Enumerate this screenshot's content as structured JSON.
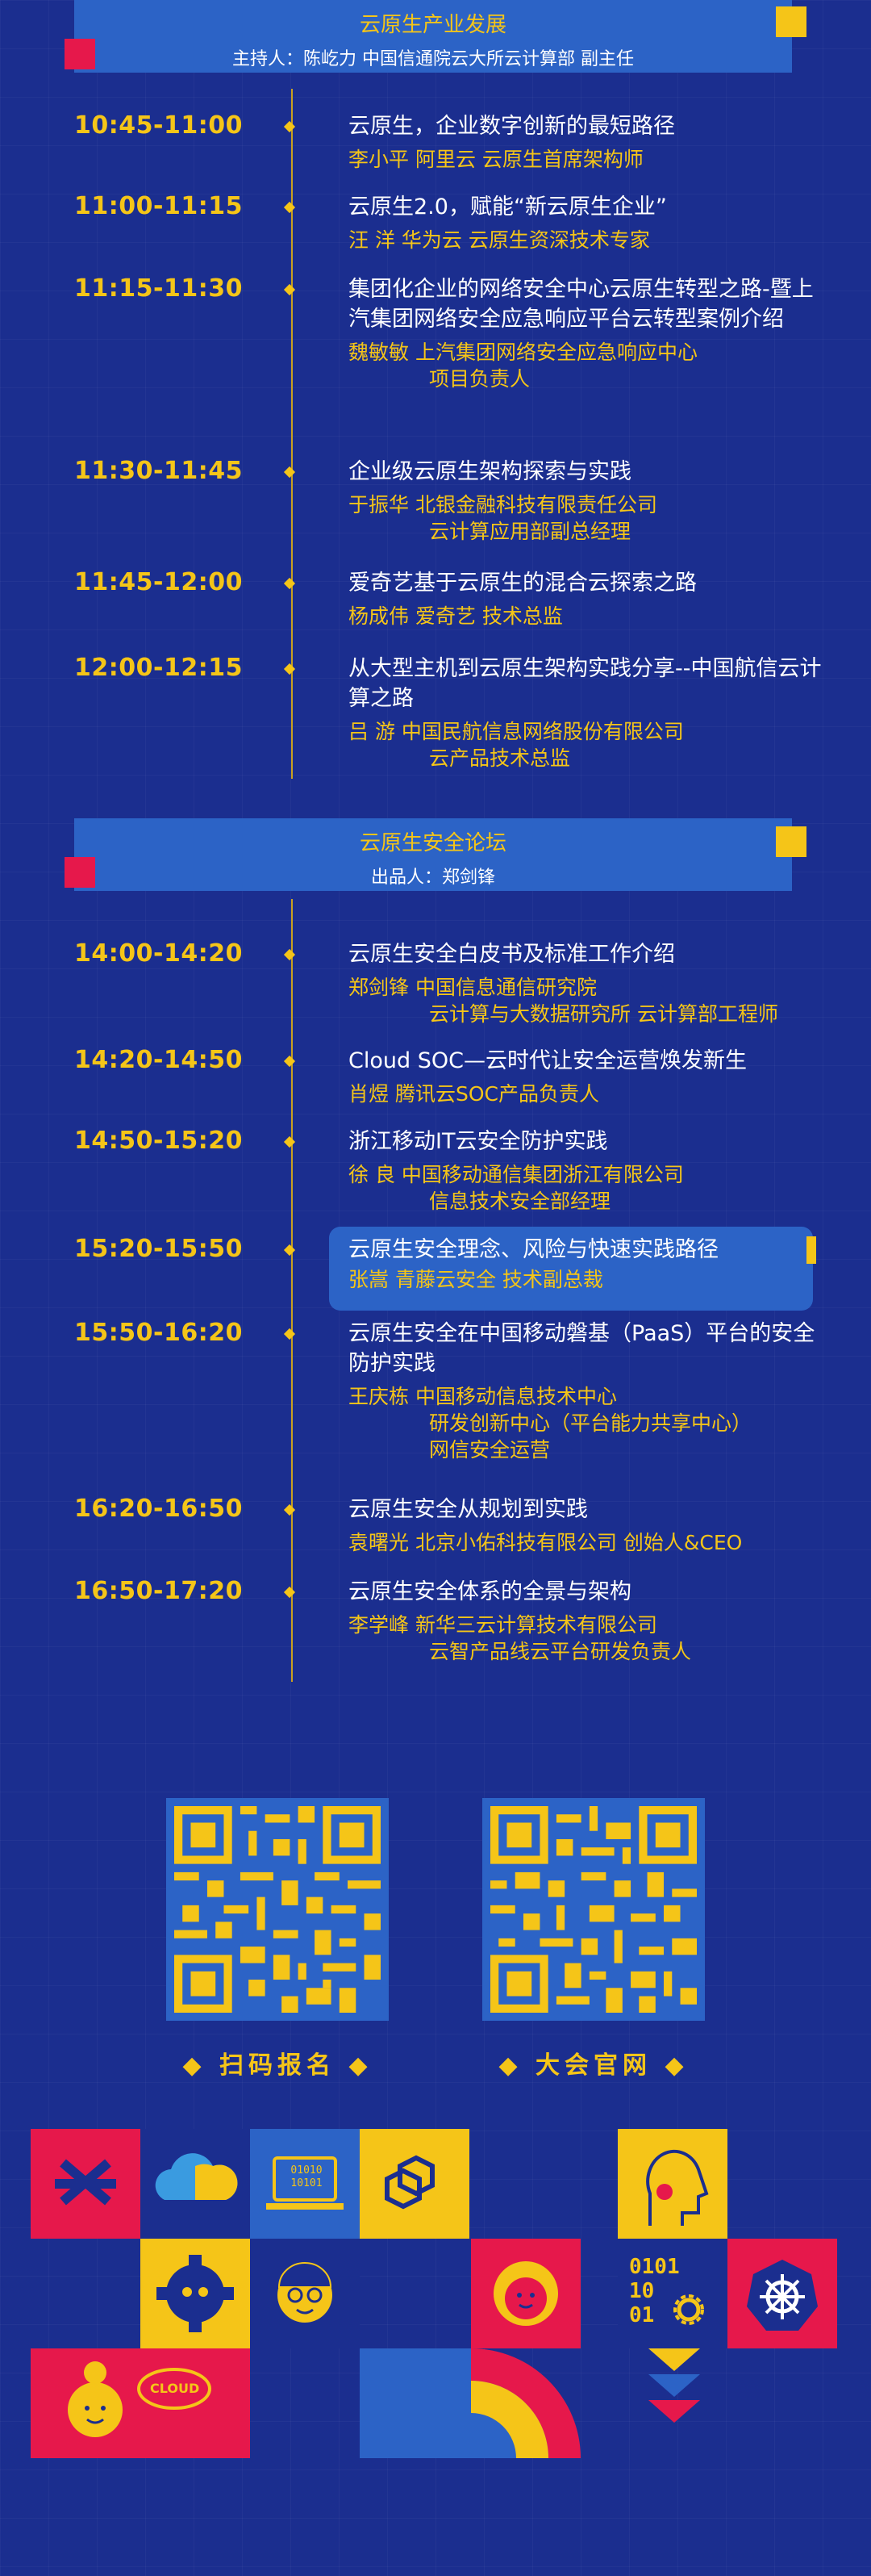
{
  "section1": {
    "title": "云原生产业发展",
    "host": "主持人：陈屹力 中国信通院云大所云计算部 副主任",
    "rows": [
      {
        "time": "10:45-11:00",
        "title": "云原生，企业数字创新的最短路径",
        "speaker": [
          "李小平  阿里云 云原生首席架构师"
        ]
      },
      {
        "time": "11:00-11:15",
        "title": "云原生2.0，赋能“新云原生企业”",
        "speaker": [
          "汪 洋    华为云 云原生资深技术专家"
        ]
      },
      {
        "time": "11:15-11:30",
        "title": "集团化企业的网络安全中心云原生转型之路-暨上汽集团网络安全应急响应平台云转型案例介绍",
        "speaker": [
          "魏敏敏  上汽集团网络安全应急响应中心",
          "项目负责人"
        ]
      },
      {
        "time": "11:30-11:45",
        "title": "企业级云原生架构探索与实践",
        "speaker": [
          "于振华  北银金融科技有限责任公司",
          "云计算应用部副总经理"
        ]
      },
      {
        "time": "11:45-12:00",
        "title": "爱奇艺基于云原生的混合云探索之路",
        "speaker": [
          "杨成伟  爱奇艺 技术总监"
        ]
      },
      {
        "time": "12:00-12:15",
        "title": "从大型主机到云原生架构实践分享--中国航信云计算之路",
        "speaker": [
          "吕 游     中国民航信息网络股份有限公司",
          "云产品技术总监"
        ]
      }
    ]
  },
  "section2": {
    "title": "云原生安全论坛",
    "host": "出品人：郑剑锋",
    "rows": [
      {
        "time": "14:00-14:20",
        "title": "云原生安全白皮书及标准工作介绍",
        "speaker": [
          "郑剑锋  中国信息通信研究院",
          "云计算与大数据研究所 云计算部工程师"
        ]
      },
      {
        "time": "14:20-14:50",
        "title": "Cloud SOC—云时代让安全运营焕发新生",
        "speaker": [
          "肖煜  腾讯云SOC产品负责人"
        ]
      },
      {
        "time": "14:50-15:20",
        "title": "浙江移动IT云安全防护实践",
        "speaker": [
          "徐 良     中国移动通信集团浙江有限公司",
          "信息技术安全部经理"
        ]
      },
      {
        "time": "15:20-15:50",
        "title": "云原生安全理念、风险与快速实践路径",
        "speaker": [
          "张嵩  青藤云安全 技术副总裁"
        ]
      },
      {
        "time": "15:50-16:20",
        "title": "云原生安全在中国移动磐基（PaaS）平台的安全防护实践",
        "speaker": [
          "王庆栋 中国移动信息技术中心",
          "研发创新中心（平台能力共享中心）",
          "网信安全运营"
        ]
      },
      {
        "time": "16:20-16:50",
        "title": "云原生安全从规划到实践",
        "speaker": [
          "袁曙光  北京小佑科技有限公司 创始人&CEO"
        ]
      },
      {
        "time": "16:50-17:20",
        "title": "云原生安全体系的全景与架构",
        "speaker": [
          "李学峰  新华三云计算技术有限公司",
          "云智产品线云平台研发负责人"
        ]
      }
    ]
  },
  "qr": {
    "left_label": "扫码报名",
    "right_label": "大会官网"
  },
  "tiles": {
    "cloud_bubble": "CLOUD",
    "binary_left": "01010\n10101",
    "binary_right": "0101\n10\n01"
  },
  "colors": {
    "background": "#1b2e8f",
    "accent_yellow": "#f5c518",
    "accent_red": "#e6184b",
    "accent_blue": "#2c63c6"
  }
}
